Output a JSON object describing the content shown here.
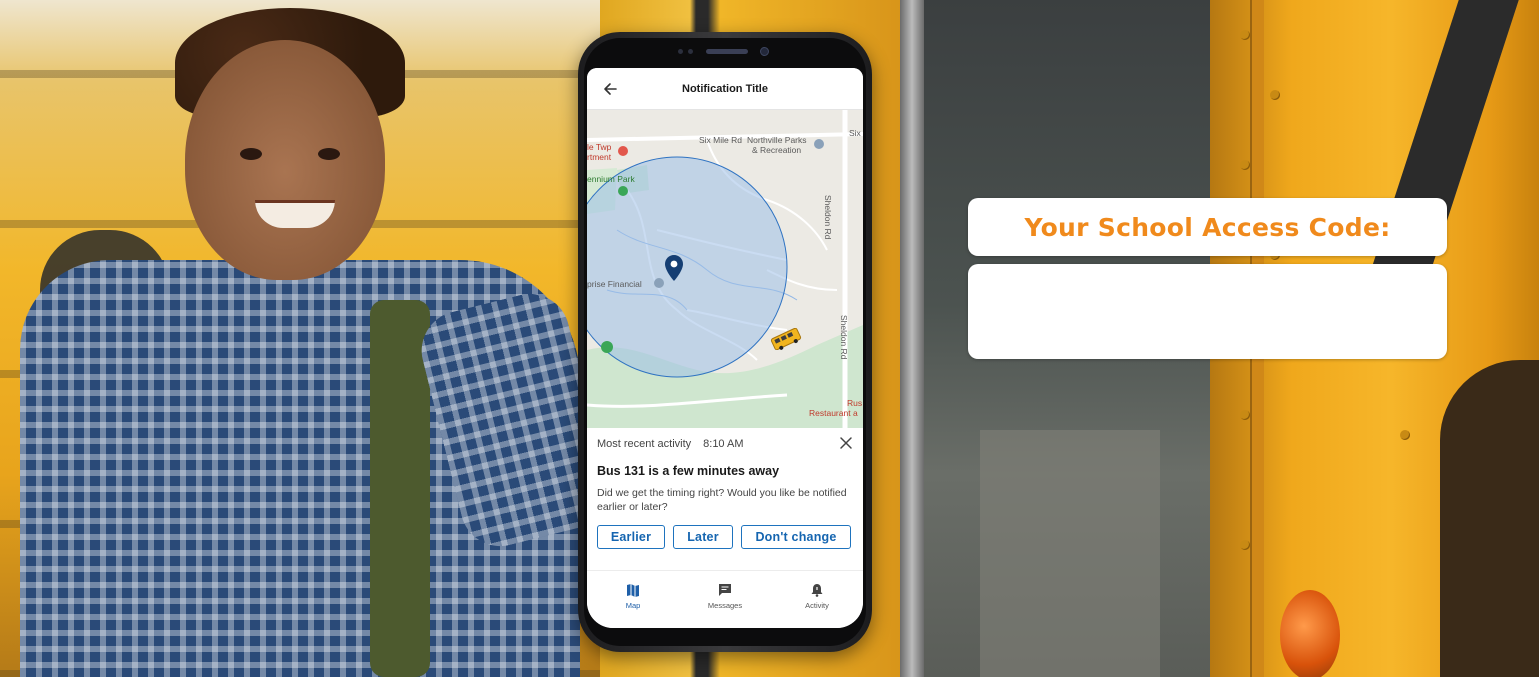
{
  "phone": {
    "header": {
      "title": "Notification Title",
      "back_icon": "arrow-left-icon"
    },
    "map": {
      "labels": [
        "Six Mile Rd",
        "Northville Parks",
        "& Recreation",
        "le Twp",
        "rtment",
        "ennium Park",
        "Sheldon Rd",
        "Sheldon Rd",
        "prise Financial",
        "Rus",
        "Restaurant a",
        "Six"
      ],
      "geofence_color": "#9fc0e8",
      "pin_color": "#153e73",
      "bus_icon": "school-bus-icon"
    },
    "activity_sheet": {
      "recent_label": "Most recent activity",
      "time": "8:10 AM",
      "heading": "Bus 131 is a few minutes away",
      "body": "Did we get the timing right? Would you like be notified earlier or later?",
      "buttons": {
        "earlier": "Earlier",
        "later": "Later",
        "no_change": "Don't change"
      }
    },
    "tabs": [
      {
        "label": "Map",
        "icon": "map-icon",
        "active": true
      },
      {
        "label": "Messages",
        "icon": "message-icon",
        "active": false
      },
      {
        "label": "Activity",
        "icon": "bell-icon",
        "active": false
      }
    ]
  },
  "access_code": {
    "title": "Your School Access Code:",
    "value": ""
  },
  "colors": {
    "accent_orange": "#f08a1c",
    "button_blue": "#1e73be"
  }
}
